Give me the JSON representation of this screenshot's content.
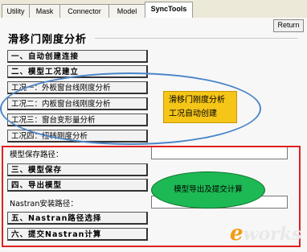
{
  "tabs": [
    {
      "label": "Utility"
    },
    {
      "label": "Mask"
    },
    {
      "label": "Connector"
    },
    {
      "label": "Model"
    },
    {
      "label": "SyncTools"
    }
  ],
  "return_label": "Return",
  "section_title": "滑移门刚度分析",
  "buttons": {
    "b1": "一、自动创建连接",
    "b2": "二、模型工况建立",
    "c1": "工况一：外板窗台线刚度分析",
    "c2": "工况二：内板窗台线刚度分析",
    "c3": "工况三：窗台变形量分析",
    "c4": "工况四：扭转刚度分析",
    "b3": "三、模型保存",
    "b4": "四、导出模型",
    "b5": "五、Nastran路径选择",
    "b6": "六、提交Nastran计算"
  },
  "labels": {
    "model_path": "模型保存路径：",
    "nastran_path": "Nastran安装路径："
  },
  "fields": {
    "model_path_value": "",
    "nastran_path_value": ""
  },
  "annotations": {
    "yellow_line1": "滑移门刚度分析",
    "yellow_line2": "工况自动创建",
    "green_text": "模型导出及提交计算"
  },
  "logo": {
    "c": "e",
    "rest": "works"
  },
  "colors": {
    "highlight_blue": "#4b86c8",
    "highlight_red": "#e02020",
    "note_yellow": "#f5c518",
    "note_green": "#1db954"
  }
}
